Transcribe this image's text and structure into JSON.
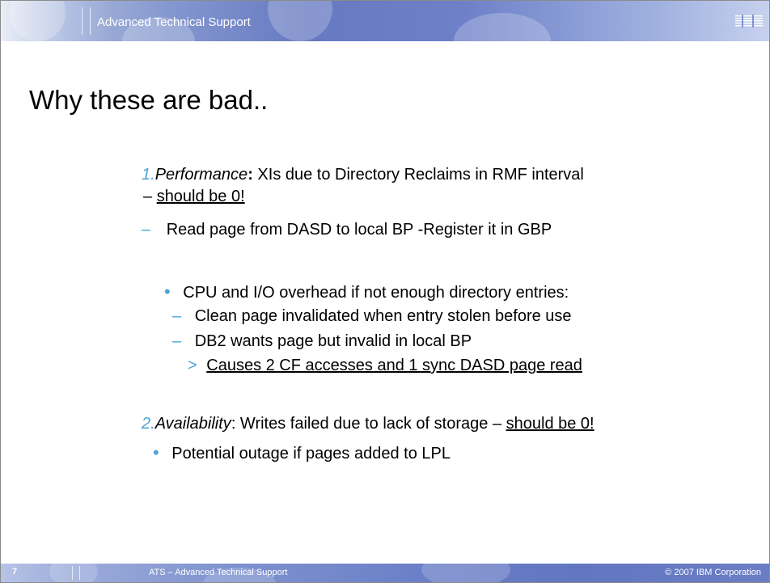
{
  "header": {
    "title": "Advanced Technical Support",
    "logo_text": "IBM"
  },
  "slide": {
    "title": "Why these are bad..",
    "item1": {
      "number": "1.",
      "label": "Performance",
      "colon": ":",
      "text": " XIs due to Directory Reclaims in RMF interval",
      "cont_dash": "– ",
      "cont_underlined": "should be 0!",
      "sub_dash": "–",
      "sub_text": "Read page from DASD to local BP -Register it in GBP",
      "bullet_marker": "•",
      "bullet_text": "CPU and I/O overhead if not enough directory entries:",
      "dash_a": "–",
      "dash_a_text": "Clean page invalidated when entry stolen before use",
      "dash_b": "–",
      "dash_b_text": "DB2 wants page but invalid in local BP",
      "gt_marker": ">",
      "gt_text": "Causes 2 CF accesses and 1 sync DASD page read"
    },
    "item2": {
      "number": "2.",
      "label": "Availability",
      "text": ": Writes failed due to lack of storage – ",
      "underlined": "should be 0!",
      "bullet_marker": "•",
      "bullet_text": "Potential outage if pages added to LPL"
    }
  },
  "footer": {
    "page_number": "7",
    "center": "ATS – Advanced Technical Support",
    "copyright": "© 2007 IBM Corporation"
  },
  "colors": {
    "accent": "#4ba3d6",
    "header_blue": "#6679c1"
  }
}
